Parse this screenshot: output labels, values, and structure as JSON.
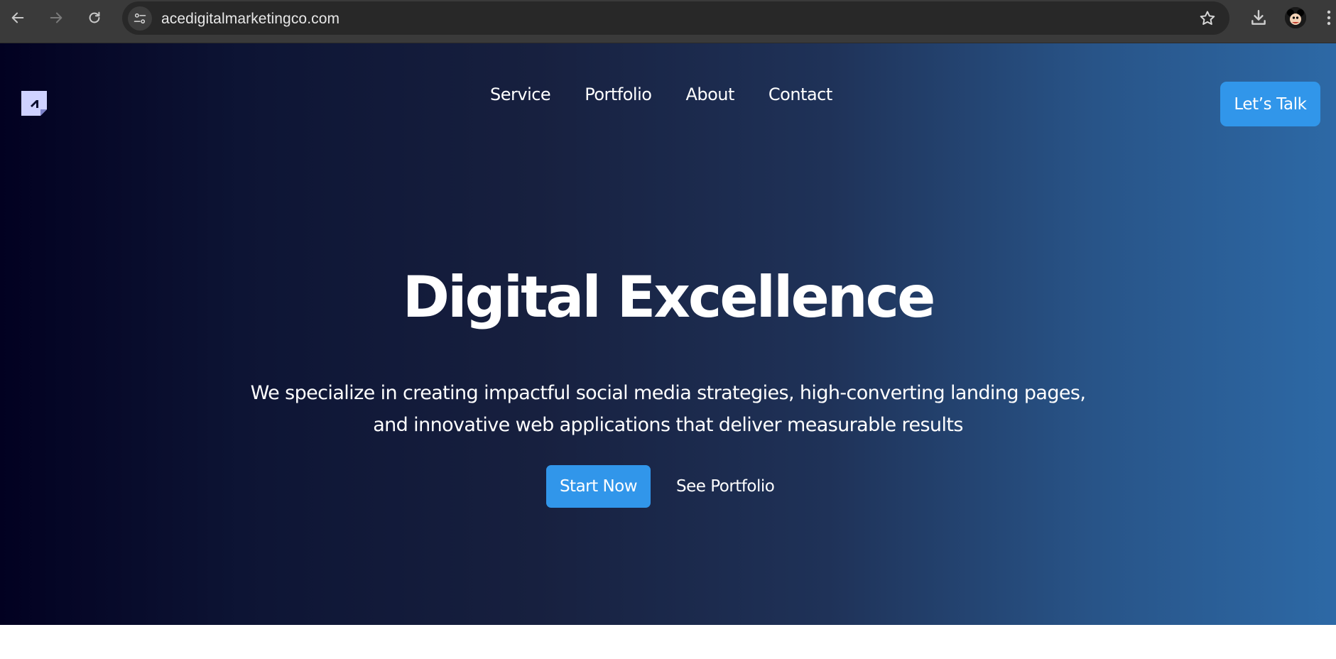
{
  "browser": {
    "url": "acedigitalmarketingco.com",
    "icons": {
      "back": "back-arrow-icon",
      "forward": "forward-arrow-icon",
      "reload": "reload-icon",
      "site_info": "tune-icon",
      "bookmark": "star-icon",
      "download": "download-icon",
      "profile": "avatar",
      "menu": "kebab-menu-icon"
    }
  },
  "site": {
    "nav": {
      "items": [
        {
          "label": "Service"
        },
        {
          "label": "Portfolio"
        },
        {
          "label": "About"
        },
        {
          "label": "Contact"
        }
      ],
      "cta_label": "Let’s Talk"
    },
    "hero": {
      "title": "Digital Excellence",
      "subtitle_line1": "We specialize in creating impactful social media strategies, high-converting landing pages,",
      "subtitle_line2": "and innovative web applications that deliver measurable results",
      "primary_cta": "Start Now",
      "secondary_cta": "See Portfolio"
    },
    "colors": {
      "accent": "#3196ea",
      "gradient_start": "#020121",
      "gradient_end": "#2d69a6",
      "logo": "#cfd2ff"
    }
  }
}
